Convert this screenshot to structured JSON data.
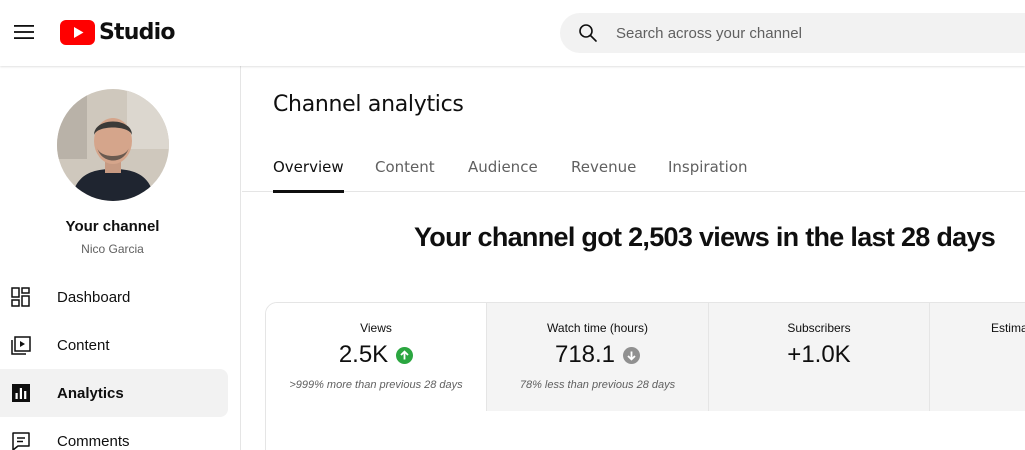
{
  "header": {
    "logo_text": "Studio",
    "search_placeholder": "Search across your channel"
  },
  "sidebar": {
    "channel_title": "Your channel",
    "channel_name": "Nico Garcia",
    "items": [
      {
        "label": "Dashboard",
        "icon": "dashboard-icon"
      },
      {
        "label": "Content",
        "icon": "content-icon"
      },
      {
        "label": "Analytics",
        "icon": "analytics-icon",
        "active": true
      },
      {
        "label": "Comments",
        "icon": "comments-icon"
      }
    ]
  },
  "main": {
    "title": "Channel analytics",
    "tabs": [
      "Overview",
      "Content",
      "Audience",
      "Revenue",
      "Inspiration"
    ],
    "active_tab": "Overview",
    "headline": "Your channel got 2,503 views in the last 28 days",
    "metrics": [
      {
        "label": "Views",
        "value": "2.5K",
        "trend": "up",
        "note": ">999% more than previous 28 days"
      },
      {
        "label": "Watch time (hours)",
        "value": "718.1",
        "trend": "down",
        "note": "78% less than previous 28 days"
      },
      {
        "label": "Subscribers",
        "value": "+1.0K",
        "trend": "",
        "note": ""
      },
      {
        "label": "Estimated revenue",
        "value": "$",
        "trend": "",
        "note": ""
      }
    ]
  },
  "colors": {
    "brand_red": "#ff0000",
    "trend_up": "#2ba640",
    "trend_down": "#909090"
  }
}
